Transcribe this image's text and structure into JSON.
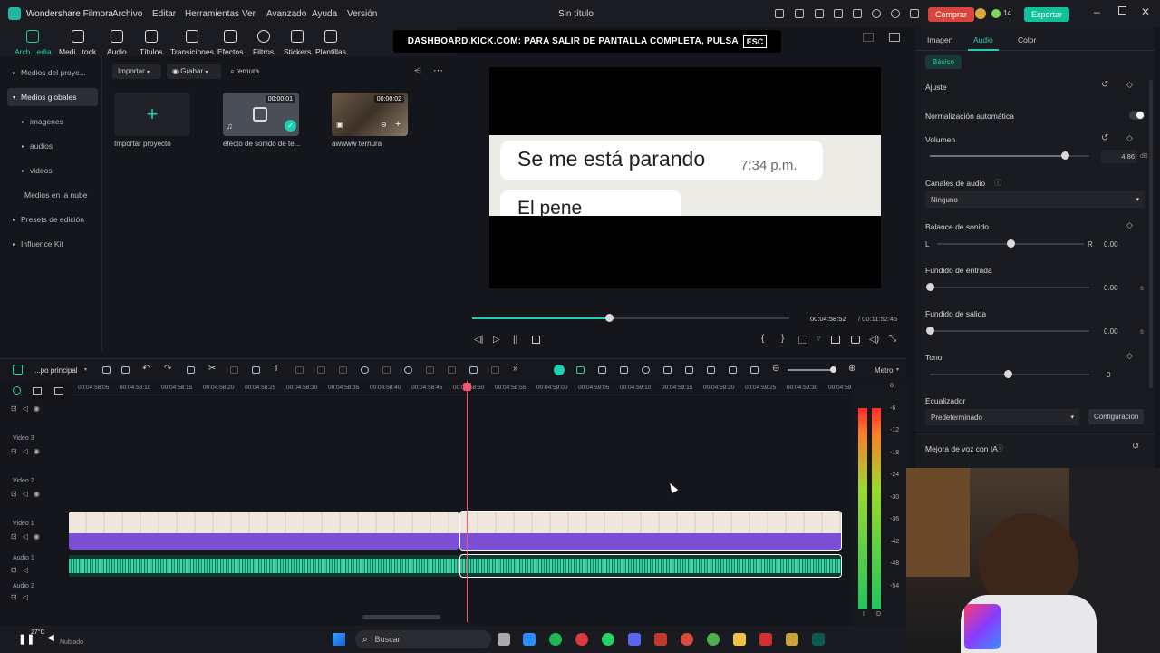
{
  "app": {
    "name": "Wondershare Filmora",
    "window_title": "Sin título",
    "menu": [
      "Archivo",
      "Editar",
      "Herramientas",
      "Ver",
      "Avanzado",
      "Ayuda",
      "Versión"
    ],
    "buy_label": "Comprar",
    "points": "14",
    "export_label": "Exportar"
  },
  "banner": {
    "text": "DASHBOARD.KICK.COM: PARA SALIR DE PANTALLA COMPLETA, PULSA",
    "key": "ESC"
  },
  "toolbar": {
    "items": [
      {
        "label": "Arch...edia",
        "icon": "folder-icon"
      },
      {
        "label": "Medi...tock",
        "icon": "stock-media-icon"
      },
      {
        "label": "Audio",
        "icon": "music-note-icon"
      },
      {
        "label": "Títulos",
        "icon": "text-icon"
      },
      {
        "label": "Transiciones",
        "icon": "transition-icon"
      },
      {
        "label": "Efectos",
        "icon": "effects-icon"
      },
      {
        "label": "Filtros",
        "icon": "filter-icon"
      },
      {
        "label": "Stickers",
        "icon": "sticker-icon"
      },
      {
        "label": "Plantillas",
        "icon": "template-icon"
      }
    ]
  },
  "sidebar": {
    "items": [
      {
        "label": "Medios del proye..."
      },
      {
        "label": "Medios globales"
      },
      {
        "label": "imagenes"
      },
      {
        "label": "audios"
      },
      {
        "label": "videos"
      },
      {
        "label": "Medios en la nube"
      },
      {
        "label": "Presets de edición"
      },
      {
        "label": "Influence Kit"
      }
    ]
  },
  "media": {
    "import_label": "Importar",
    "record_label": "Grabar",
    "search_value": "ternura",
    "items": [
      {
        "label": "Importar proyecto"
      },
      {
        "label": "efecto de sonido de te...",
        "duration": "00:00:01"
      },
      {
        "label": "awwww ternura",
        "duration": "00:00:02"
      }
    ]
  },
  "preview": {
    "message_text": "Se me está parando",
    "message_time": "7:34 p.m.",
    "message_text_2": "El pene",
    "current_time": "00:04:58:52",
    "total_time": "/ 00:11:52:45",
    "progress": 0.43
  },
  "right_panel": {
    "tabs": [
      "Imagen",
      "Audio",
      "Color"
    ],
    "subtab": "Básico",
    "section": "Ajuste",
    "auto_normalize_label": "Normalización automática",
    "volume_label": "Volumen",
    "volume_value": "4.86",
    "volume_unit": "dB",
    "channels_label": "Canales de audio",
    "channels_value": "Ninguno",
    "balance_label": "Balance de sonido",
    "balance_l": "L",
    "balance_r": "R",
    "balance_value": "0.00",
    "fade_in_label": "Fundido de entrada",
    "fade_in_value": "0.00",
    "fade_out_label": "Fundido  de salida",
    "fade_out_value": "0.00",
    "seconds_unit": "s",
    "tone_label": "Tono",
    "tone_value": "0",
    "eq_label": "Ecualizador",
    "eq_value": "Predeterminado",
    "eq_config": "Configuración",
    "voice_label": "Mejora de voz con IA"
  },
  "timeline": {
    "track_name": "...po principal",
    "meter_label": "Metro",
    "ruler": [
      "00:04:58:05",
      "00:04:58:10",
      "00:04:58:15",
      "00:04:58:20",
      "00:04:58:25",
      "00:04:58:30",
      "00:04:58:35",
      "00:04:58:40",
      "00:04:58:45",
      "00:04:58:50",
      "00:04:58:55",
      "00:04:59:00",
      "00:04:59:05",
      "00:04:59:10",
      "00:04:59:15",
      "00:04:59:20",
      "00:04:59:25",
      "00:04:59:30",
      "00:04:59:35"
    ],
    "tracks": [
      "Video 3",
      "Video 2",
      "Video 1",
      "Audio 1",
      "Audio 2"
    ],
    "db_scale": [
      "0",
      "-6",
      "-12",
      "-18",
      "-24",
      "-30",
      "-36",
      "-42",
      "-48",
      "-54"
    ],
    "meter_lr": [
      "I",
      "D"
    ]
  },
  "taskbar": {
    "weather": "27°C",
    "weather_desc": "Nublado",
    "search_placeholder": "Buscar"
  }
}
